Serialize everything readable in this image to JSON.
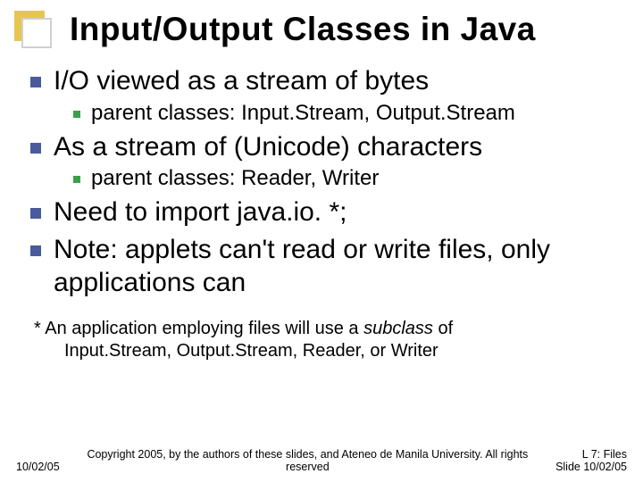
{
  "title": "Input/Output Classes in Java",
  "bullets": {
    "b1": {
      "text": "I/O viewed as a stream of bytes"
    },
    "b1a": {
      "text": "parent classes:  Input.Stream, Output.Stream"
    },
    "b2": {
      "text": "As a stream of (Unicode) characters"
    },
    "b2a": {
      "text": "parent classes:  Reader, Writer"
    },
    "b3": {
      "text": "Need to import java.io. *;"
    },
    "b4": {
      "text": "Note: applets can't read or write files, only applications can"
    }
  },
  "note": {
    "line1_prefix": "* An application employing files will use a ",
    "line1_italic": "subclass",
    "line1_suffix": " of",
    "line2": "Input.Stream, Output.Stream, Reader, or Writer"
  },
  "footer": {
    "left": "10/02/05",
    "center": "Copyright 2005, by the authors of these slides, and Ateneo de Manila University. All rights reserved",
    "right1": "L 7: Files",
    "right2": "Slide 10/02/05"
  }
}
